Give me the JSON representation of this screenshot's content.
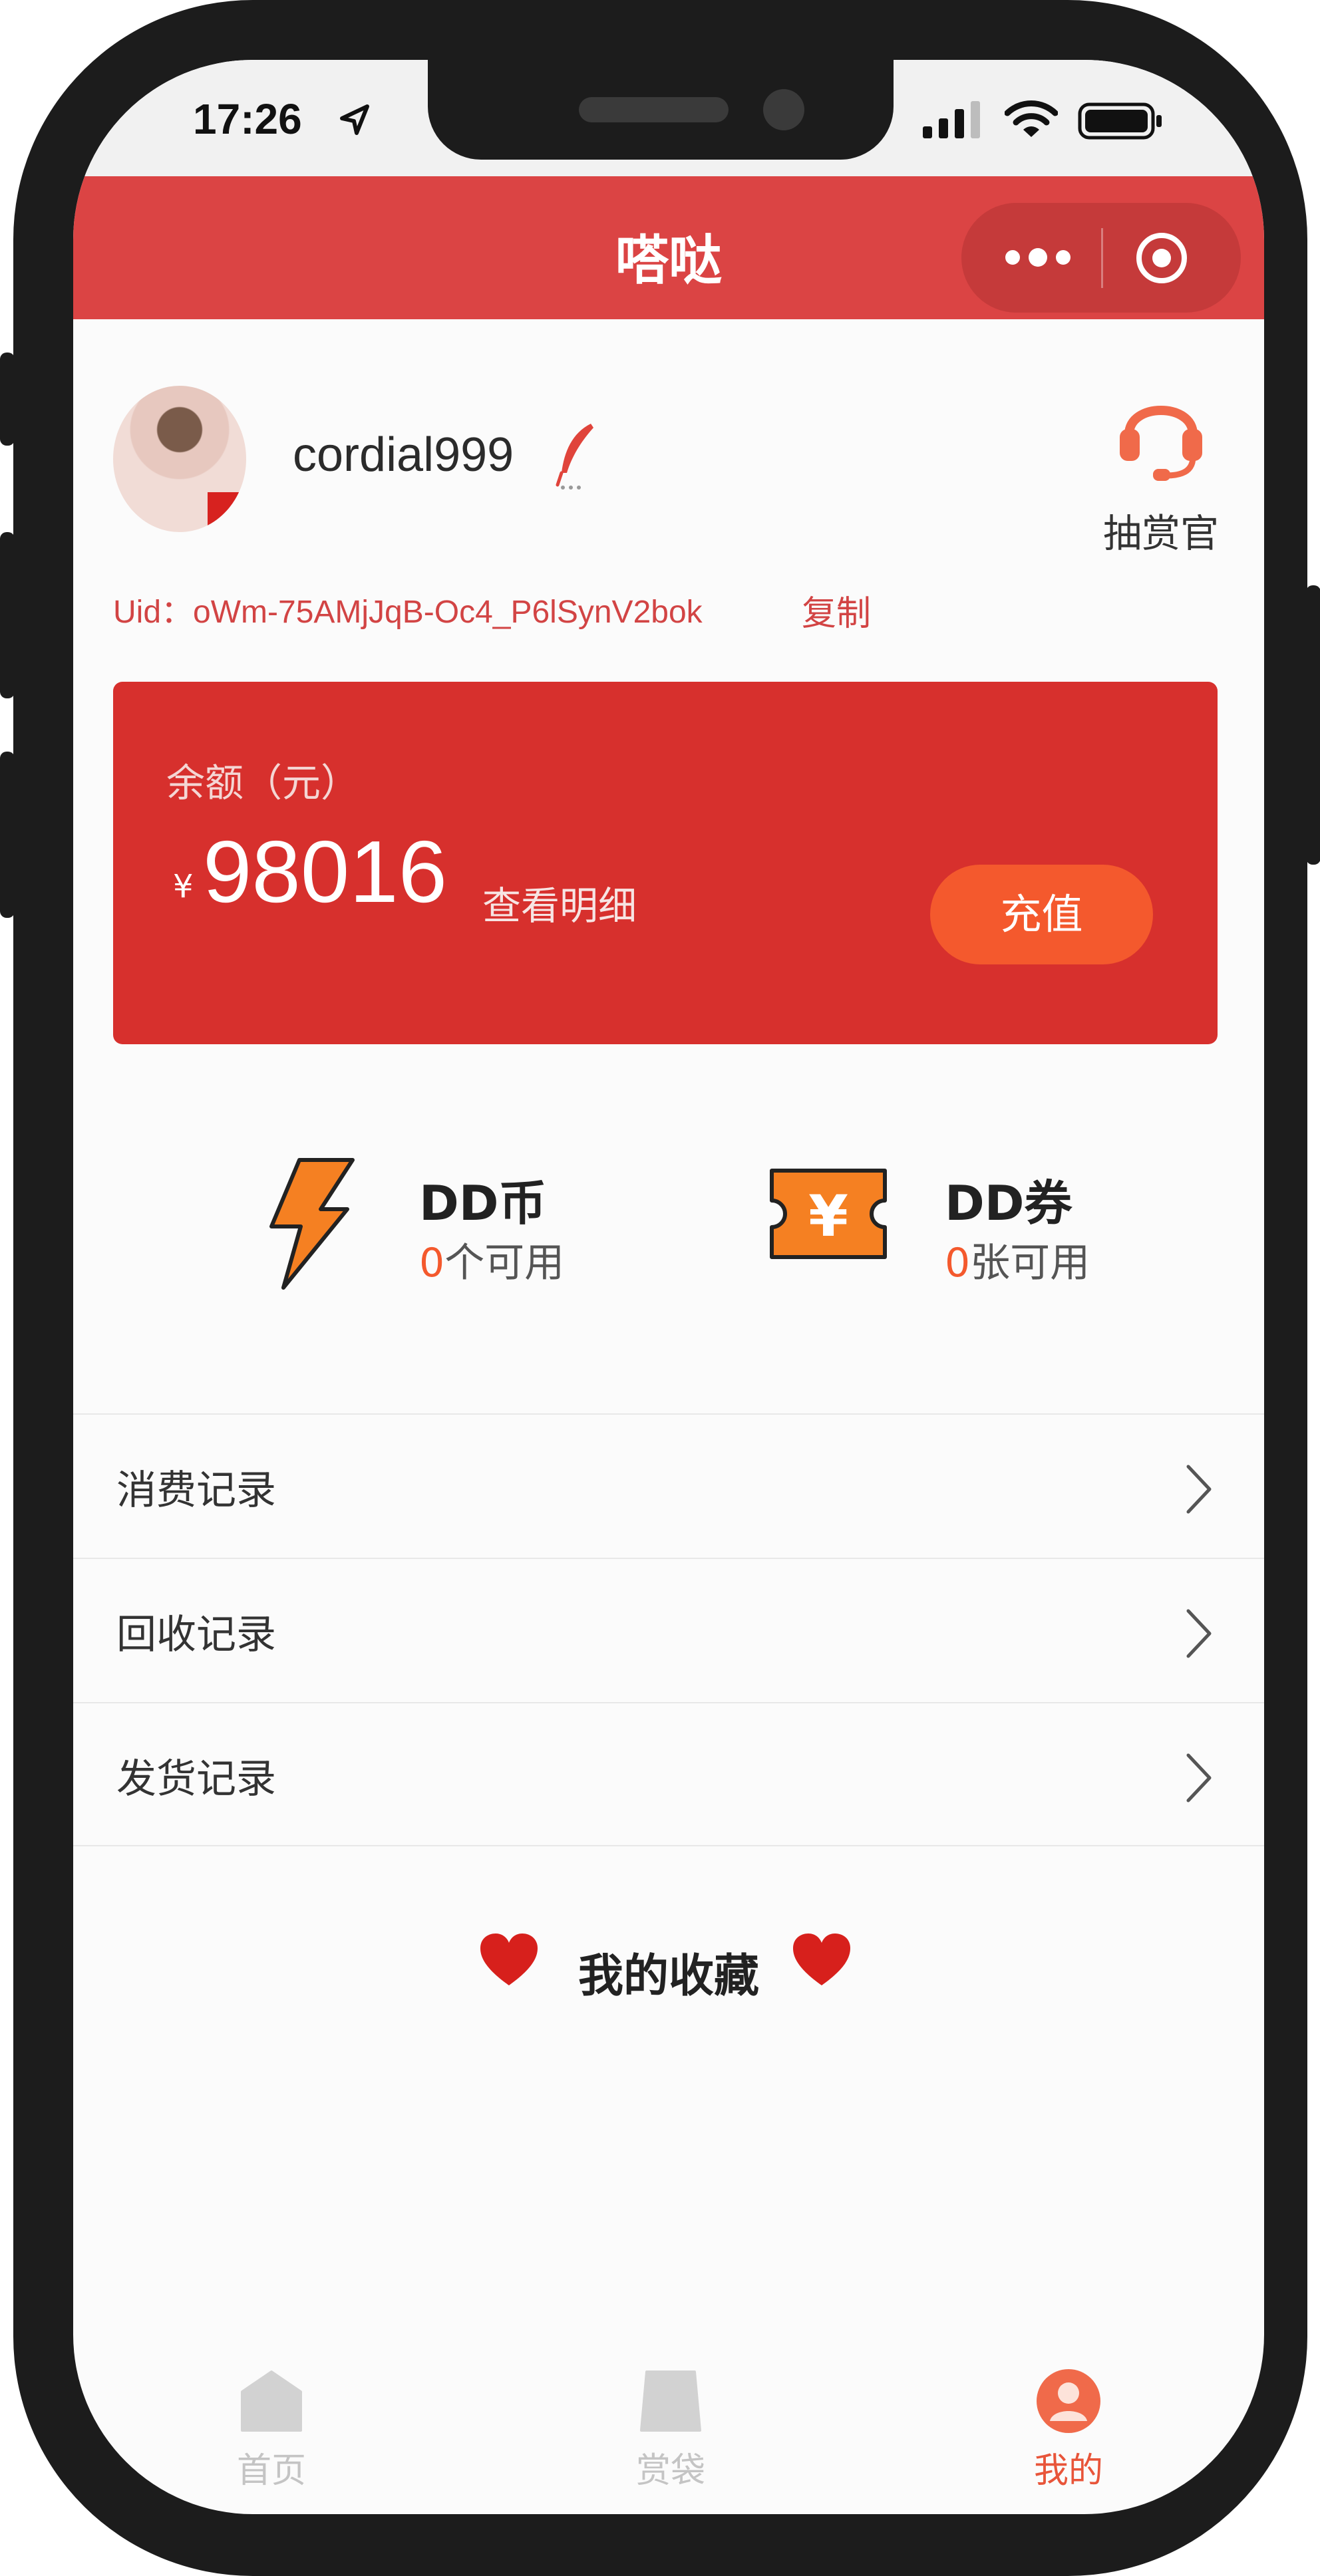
{
  "status_bar": {
    "time": "17:26"
  },
  "header": {
    "title": "嗒哒"
  },
  "profile": {
    "username": "cordial999",
    "service_label": "抽赏官",
    "uid": "Uid：oWm-75AMjJqB-Oc4_P6lSynV2bok",
    "copy_label": "复制"
  },
  "balance": {
    "label": "余额（元）",
    "currency_symbol": "¥",
    "amount": "98016",
    "detail_label": "查看明细",
    "recharge_label": "充值"
  },
  "assets": [
    {
      "title": "DD币",
      "count": "0",
      "suffix": "个可用",
      "icon": "lightning-icon"
    },
    {
      "title": "DD券",
      "count": "0",
      "suffix": "张可用",
      "icon": "ticket-icon"
    }
  ],
  "menu": [
    {
      "label": "消费记录"
    },
    {
      "label": "回收记录"
    },
    {
      "label": "发货记录"
    }
  ],
  "favorites": {
    "title": "我的收藏"
  },
  "tabbar": [
    {
      "label": "首页",
      "icon": "home-icon",
      "active": false
    },
    {
      "label": "赏袋",
      "icon": "bag-icon",
      "active": false
    },
    {
      "label": "我的",
      "icon": "profile-icon",
      "active": true
    }
  ],
  "colors": {
    "header_red": "#db4444",
    "card_red": "#d7302d",
    "accent_orange": "#f4592d",
    "link_red": "#d24444"
  }
}
